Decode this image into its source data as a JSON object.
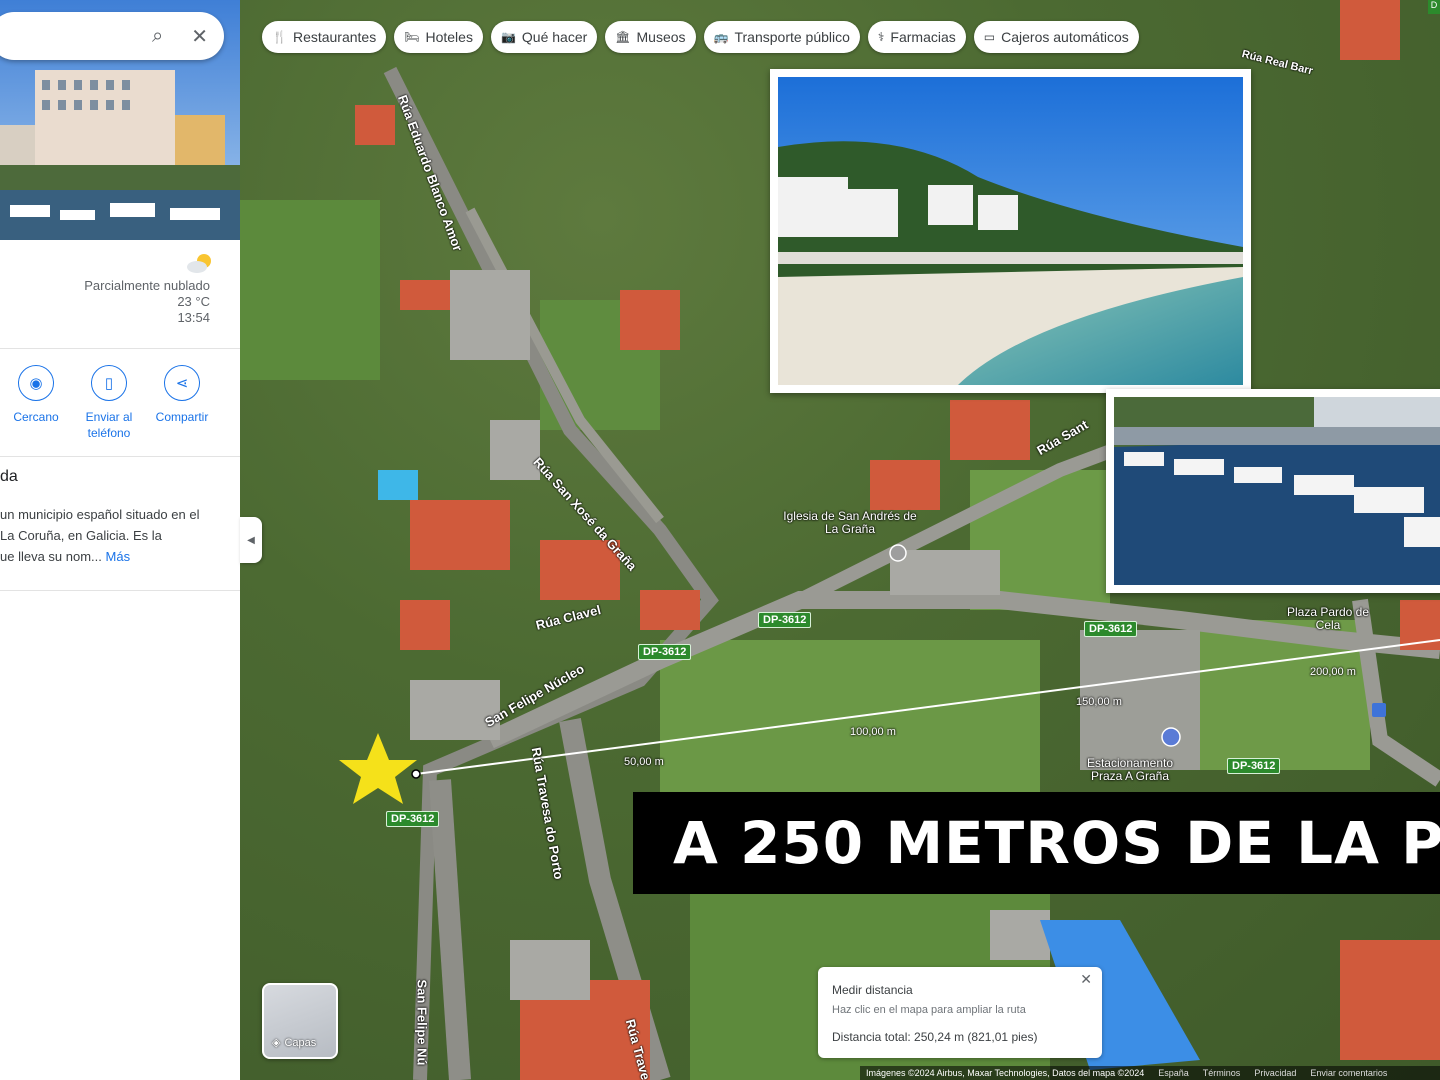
{
  "search": {
    "value": "",
    "search_icon": "search-icon",
    "close_icon": "close-icon"
  },
  "weather": {
    "condition": "Parcialmente nublado",
    "temperature": "23 °C",
    "time": "13:54",
    "icon": "partly-cloudy-icon"
  },
  "actions": [
    {
      "label": "Cercano",
      "icon": "nearby-icon"
    },
    {
      "label": "Enviar al teléfono",
      "icon": "send-to-phone-icon"
    },
    {
      "label": "Compartir",
      "icon": "share-icon"
    }
  ],
  "description": {
    "title_fragment": "da",
    "lines": [
      "un municipio español situado en el",
      " La Coruña, en Galicia. Es la",
      "ue lleva su nom..."
    ],
    "more_label": "Más"
  },
  "chips": [
    {
      "label": "Restaurantes",
      "icon": "fork-knife-icon",
      "glyph": "🍴"
    },
    {
      "label": "Hoteles",
      "icon": "bed-icon",
      "glyph": "🛏"
    },
    {
      "label": "Qué hacer",
      "icon": "camera-icon",
      "glyph": "📷"
    },
    {
      "label": "Museos",
      "icon": "museum-icon",
      "glyph": "🏛"
    },
    {
      "label": "Transporte público",
      "icon": "bus-icon",
      "glyph": "🚌"
    },
    {
      "label": "Farmacias",
      "icon": "pharmacy-icon",
      "glyph": "⚕"
    },
    {
      "label": "Cajeros automáticos",
      "icon": "atm-icon",
      "glyph": "▭"
    }
  ],
  "map": {
    "roads": [
      {
        "name": "Rúa Eduardo Blanco Amor"
      },
      {
        "name": "Rúa San Xosé da Graña"
      },
      {
        "name": "Rúa Clavel"
      },
      {
        "name": "San Felipe Núcleo"
      },
      {
        "name": "Rúa Travesa do Porto"
      },
      {
        "name": "San Felipe Nú"
      },
      {
        "name": "Rúa Trave"
      },
      {
        "name": "Rúa Sant"
      },
      {
        "name": "Rúa Real Barr"
      }
    ],
    "pois": [
      {
        "name": "Iglesia de San Andrés de La Graña"
      },
      {
        "name": "Plaza Pardo de Cela"
      },
      {
        "name": "Estacionamento Praza A Graña"
      }
    ],
    "route_shield": "DP-3612",
    "distances": [
      "50,00 m",
      "100,00 m",
      "150,00 m",
      "200,00 m"
    ]
  },
  "banner": {
    "text": "A 250 METROS DE LA P"
  },
  "layers": {
    "label": "Capas",
    "icon": "layers-icon"
  },
  "measure": {
    "title": "Medir distancia",
    "hint": "Haz clic en el mapa para ampliar la ruta",
    "total": "Distancia total: 250,24 m (821,01 pies)",
    "close_icon": "close-icon"
  },
  "attribution": {
    "imagery": "Imágenes ©2024 Airbus, Maxar Technologies, Datos del mapa ©2024",
    "links": [
      "España",
      "Términos",
      "Privacidad",
      "Enviar comentarios"
    ]
  },
  "corner_badge": "D",
  "colors": {
    "accent": "#1a73e8",
    "route_green": "#2c8a2c",
    "star": "#f5e11a"
  }
}
